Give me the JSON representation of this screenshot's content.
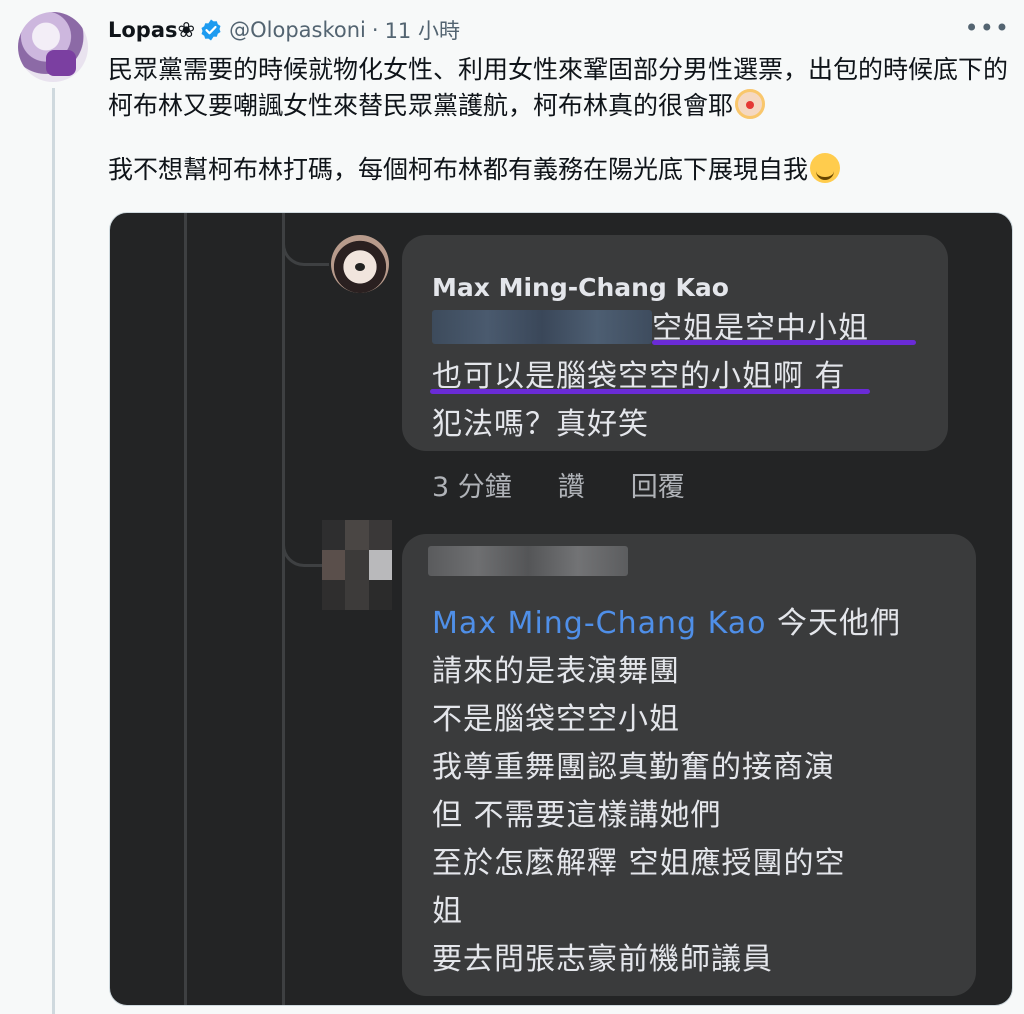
{
  "tweet": {
    "display_name": "Lopas❀",
    "handle": "@Olopaskoni",
    "separator": "·",
    "time": "11 小時",
    "more_label": "•••",
    "paragraph1": "民眾黨需要的時候就物化女性、利用女性來鞏固部分男性選票，出包的時候底下的柯布林又要嘲諷女性來替民眾黨護航，柯布林真的很會耶",
    "paragraph2": "我不想幫柯布林打碼，每個柯布林都有義務在陽光底下展現自我",
    "emoji1": "clown-face-icon",
    "emoji2": "smiling-face-icon"
  },
  "screenshot": {
    "comment1": {
      "author": "Max Ming-Chang Kao",
      "line1": "空姐是空中小姐",
      "line2": "也可以是腦袋空空的小姐啊 有",
      "line3": "犯法嗎？真好笑",
      "time": "3 分鐘",
      "like": "讚",
      "reply": "回覆"
    },
    "comment2": {
      "mention": "Max Ming-Chang Kao",
      "lines": [
        "今天他們",
        "請來的是表演舞團",
        "不是腦袋空空小姐",
        "我尊重舞團認真勤奮的接商演",
        "但  不需要這樣講她們",
        "至於怎麼解釋 空姐應授團的空",
        "姐",
        "要去問張志豪前機師議員"
      ]
    }
  },
  "colors": {
    "accent": "#1d9bf0",
    "underline": "#6a2bd6",
    "mention": "#4f8fe8"
  }
}
